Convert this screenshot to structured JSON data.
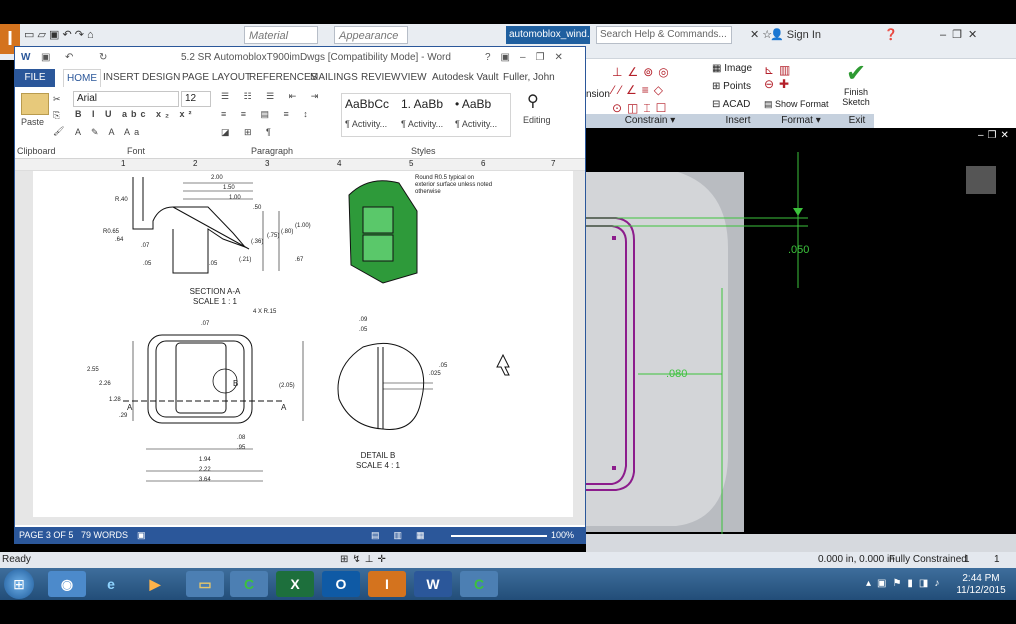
{
  "inventor": {
    "material_placeholder": "Material",
    "appearance_placeholder": "Appearance",
    "document_tab": "automoblox_wind...",
    "search_placeholder": "Search Help & Commands...",
    "sign_in": "Sign In",
    "ribbon_labels": {
      "image": "Image",
      "points": "Points",
      "acad": "ACAD",
      "show_format": "Show Format",
      "finish_sketch": "Finish Sketch",
      "partial_left": "nsion"
    },
    "panels": [
      "Constrain ▾",
      "Insert",
      "Format ▾",
      "Exit"
    ],
    "dimensions": [
      ".050",
      ".080"
    ],
    "status": {
      "ready": "Ready",
      "coords": "0.000 in, 0.000 in",
      "constraint": "Fully Constrained",
      "count1": "1",
      "count2": "1"
    }
  },
  "word": {
    "title": "5.2 SR AutomobloxT900imDwgs [Compatibility Mode] - Word",
    "tabs": [
      "FILE",
      "HOME",
      "INSERT",
      "DESIGN",
      "PAGE LAYOUT",
      "REFERENCES",
      "MAILINGS",
      "REVIEW",
      "VIEW",
      "Autodesk Vault"
    ],
    "user": "Fuller, John",
    "font_name": "Arial",
    "font_size": "12",
    "paste_label": "Paste",
    "styles": [
      {
        "sample": "AaBbCc",
        "name": "¶ Activity..."
      },
      {
        "sample": "1. AaBb",
        "name": "¶ Activity..."
      },
      {
        "sample": "• AaBb",
        "name": "¶ Activity..."
      }
    ],
    "editing_label": "Editing",
    "group_labels": [
      "Clipboard",
      "Font",
      "Paragraph",
      "Styles"
    ],
    "ruler_numbers": [
      "1",
      "2",
      "3",
      "4",
      "5",
      "6",
      "7"
    ],
    "drawing": {
      "section_title": "SECTION A-A",
      "section_scale": "SCALE 1 : 1",
      "detail_title": "DETAIL  B",
      "detail_scale": "SCALE 4 : 1",
      "note": "Round R0.5 typical on exterior surface unless noted otherwise",
      "dims_top": [
        "2.00",
        "1.50",
        "1.00",
        ".50",
        "R.40",
        "R0.65",
        ".64",
        ".07",
        "(.36)",
        "(.75)",
        "(.80)",
        "(1.00)",
        ".67",
        ".05",
        ".05",
        "(.21)"
      ],
      "dims_bottom": [
        ".07",
        "4 X R.15",
        "2.55",
        "2.26",
        "1.28",
        ".29",
        "(2.05)",
        ".08",
        ".95",
        "1.94",
        "2.22",
        "3.64",
        "B",
        "A",
        "A"
      ],
      "dims_detail": [
        ".09",
        ".05",
        ".05",
        ".025"
      ]
    },
    "status": {
      "page": "PAGE 3 OF 5",
      "words": "79 WORDS",
      "zoom": "100%"
    }
  },
  "taskbar": {
    "time": "2:44 PM",
    "date": "11/12/2015"
  }
}
